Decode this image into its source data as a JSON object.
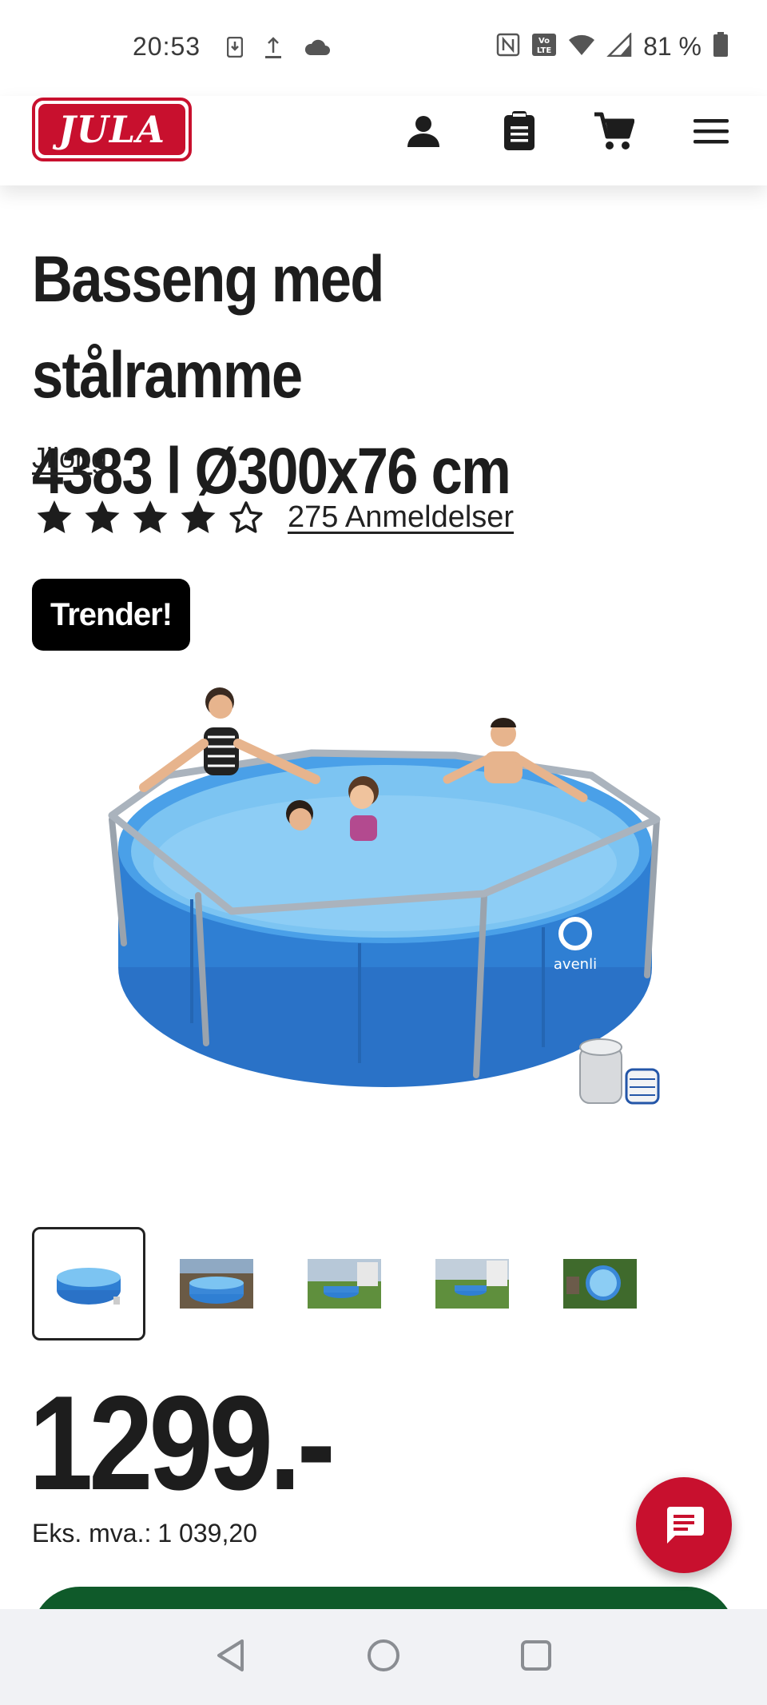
{
  "status_bar": {
    "time": "20:53",
    "battery": "81 %",
    "icons_left": [
      "download-icon",
      "upload-icon",
      "cloud-icon"
    ],
    "icons_right": [
      "nfc-icon",
      "volte-icon",
      "wifi-icon",
      "signal-icon",
      "battery-icon"
    ]
  },
  "header": {
    "logo_text": "JULA",
    "icons": [
      "account-icon",
      "clipboard-icon",
      "cart-icon",
      "menu-icon"
    ]
  },
  "product": {
    "title_line1": "Basseng med stålramme",
    "title_line2": "4383 l Ø300x76 cm",
    "brand": "Jilong",
    "rating": 4.5,
    "rating_max": 5,
    "reviews": "275 Anmeldelser",
    "badge": "Trender!",
    "image_watermark": "avenli",
    "thumbnail_count": 5,
    "price": "1299.-",
    "ex_vat_label": "Eks. mva.:",
    "ex_vat_value": "1 039,20"
  },
  "colors": {
    "brand_red": "#c8102e",
    "cta_green": "#0f5a2a",
    "badge_black": "#000000",
    "pool_blue": "#2f7fd3"
  }
}
